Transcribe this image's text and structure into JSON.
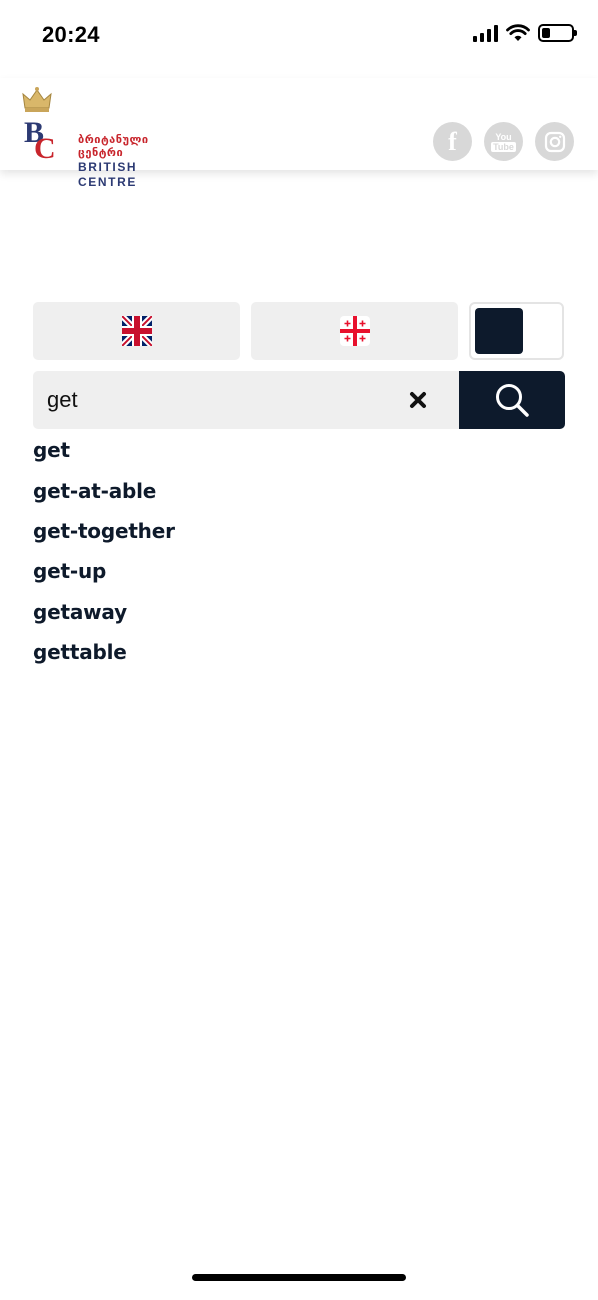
{
  "status_bar": {
    "time": "20:24"
  },
  "header": {
    "logo": {
      "monogram": "BC",
      "georgian_name": "ბრიტანული ცენტრი",
      "english_name": "BRITISH CENTRE"
    },
    "socials": [
      {
        "icon": "facebook-icon",
        "label": "f"
      },
      {
        "icon": "youtube-icon",
        "label_top": "You",
        "label_bottom": "Tube"
      },
      {
        "icon": "instagram-icon"
      }
    ]
  },
  "language": {
    "options": [
      {
        "icon": "uk-flag-icon"
      },
      {
        "icon": "georgia-flag-icon"
      }
    ],
    "toggle_state": "left"
  },
  "search": {
    "value": "get",
    "placeholder": ""
  },
  "results": [
    "get",
    "get-at-able",
    "get-together",
    "get-up",
    "getaway",
    "gettable"
  ],
  "colors": {
    "navy": "#0d1a2c",
    "field_bg": "#efefef",
    "social_gray": "#d8d8d8",
    "brand_red": "#c8252c",
    "brand_blue": "#2c3a73"
  }
}
